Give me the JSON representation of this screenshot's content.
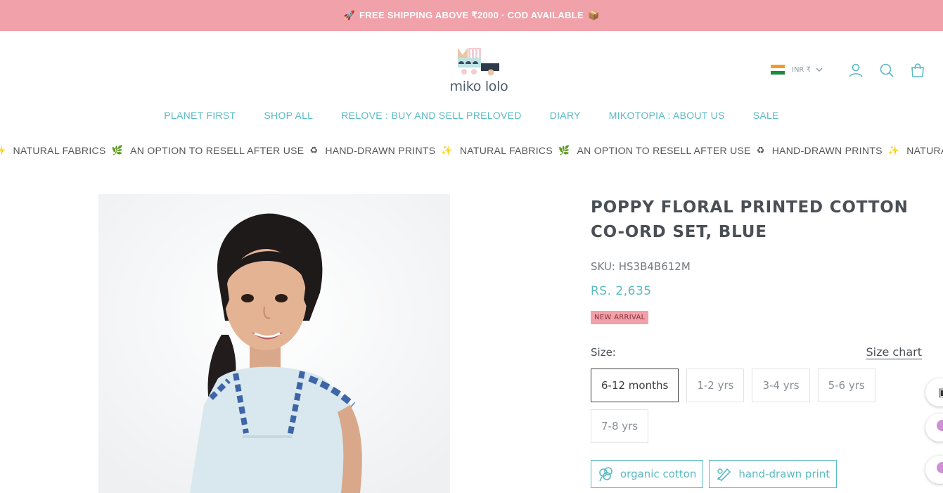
{
  "announcement": {
    "text": "FREE SHIPPING ABOVE ₹2000 · COD AVAILABLE",
    "lead_emoji": "🚀",
    "trail_emoji": "📦"
  },
  "header": {
    "logo_text": "miko lolo",
    "currency": "INR ₹",
    "icons": [
      "account-icon",
      "search-icon",
      "cart-icon"
    ]
  },
  "nav": {
    "items": [
      "PLANET FIRST",
      "SHOP ALL",
      "RELOVE : BUY AND SELL PRELOVED",
      "DIARY",
      "MIKOTOPIA : ABOUT US",
      "SALE"
    ]
  },
  "ticker": {
    "items": [
      {
        "text": "NATURAL FABRICS",
        "emoji": "🌿"
      },
      {
        "text": "AN OPTION TO RESELL AFTER USE",
        "emoji": "♻"
      },
      {
        "text": "HAND-DRAWN PRINTS",
        "emoji": "✨"
      },
      {
        "text": "NATURAL FABRICS",
        "emoji": "🌿"
      },
      {
        "text": "AN OPTION TO RESELL AFTER USE",
        "emoji": "♻"
      },
      {
        "text": "HAND-DRAWN PRINTS",
        "emoji": "✨"
      },
      {
        "text": "NATURAL FA",
        "emoji": ""
      }
    ]
  },
  "product": {
    "title": "POPPY FLORAL PRINTED COTTON CO-ORD SET, BLUE",
    "sku": "SKU: HS3B4B612M",
    "price": "RS. 2,635",
    "badge": "NEW ARRIVAL",
    "size_label": "Size:",
    "size_chart": "Size chart",
    "sizes": [
      "6-12 months",
      "1-2 yrs",
      "3-4 yrs",
      "5-6 yrs",
      "7-8 yrs"
    ],
    "selected_size": "6-12 months",
    "features": [
      "organic cotton",
      "hand-drawn print"
    ]
  },
  "colors": {
    "announce_bg": "#f1a1a9",
    "accent": "#5bbac2",
    "text_dark": "#4a4f55"
  }
}
